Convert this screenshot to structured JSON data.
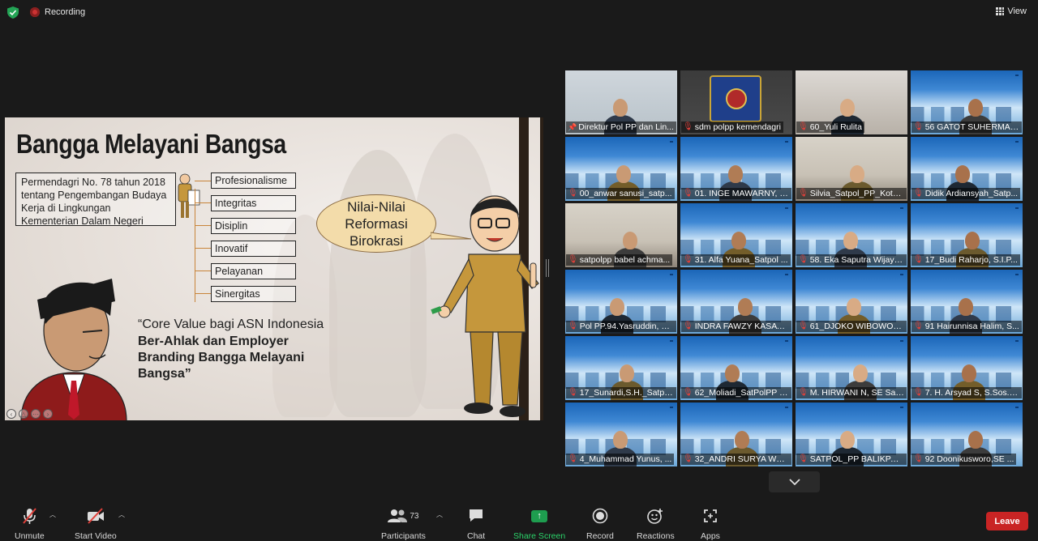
{
  "topbar": {
    "recording_label": "Recording",
    "view_label": "View"
  },
  "slide": {
    "title": "Bangga Melayani Bangsa",
    "regulation": "Permendagri No. 78 tahun 2018 tentang  Pengembangan Budaya Kerja di Lingkungan Kementerian Dalam Negeri",
    "values": [
      "Profesionalisme",
      "Integritas",
      "Disiplin",
      "Inovatif",
      "Pelayanan",
      "Sinergitas"
    ],
    "bubble": "Nilai-Nilai Reformasi Birokrasi",
    "quote_line1": "“Core Value bagi ASN Indonesia",
    "quote_line2": "Ber-Ahlak dan Employer Branding Bangga Melayani Bangsa”",
    "nav_icons": [
      "prev-icon",
      "up-icon",
      "more-icon",
      "next-icon"
    ]
  },
  "gallery": {
    "tiles": [
      {
        "name": "Direktur Pol PP dan Lin...",
        "bg": "office",
        "pinned": true
      },
      {
        "name": "sdm polpp kemendagri",
        "bg": "dark"
      },
      {
        "name": "60_Yuli Rulita",
        "bg": "gray"
      },
      {
        "name": "56 GATOT SUHERMAN...",
        "bg": "asn"
      },
      {
        "name": "00_anwar sanusi_satp...",
        "bg": "asn"
      },
      {
        "name": "01. INGE MAWARNY, S...",
        "bg": "asn"
      },
      {
        "name": "Silvia_Satpol_PP_Kota_...",
        "bg": "room"
      },
      {
        "name": "Didik Ardiansyah_Satp...",
        "bg": "asn"
      },
      {
        "name": "satpolpp babel achma...",
        "bg": "room"
      },
      {
        "name": "31. Alfa Yuana_Satpol ...",
        "bg": "asn"
      },
      {
        "name": "58. Eka Saputra Wijaya...",
        "bg": "asn"
      },
      {
        "name": "17_Budi Raharjo, S.I.P...",
        "bg": "asn"
      },
      {
        "name": "Pol PP.94.Yasruddin, S...",
        "bg": "asn"
      },
      {
        "name": "INDRA FAWZY KASATP...",
        "bg": "asn"
      },
      {
        "name": "61_DJOKO WIBOWO_...",
        "bg": "asn"
      },
      {
        "name": "91 Hairunnisa Halim, S...",
        "bg": "asn"
      },
      {
        "name": "17_Sunardi,S.H._Satpol...",
        "bg": "asn"
      },
      {
        "name": "62_Moliadi_SatPolPP K...",
        "bg": "asn"
      },
      {
        "name": "M. HIRWANI N, SE Sat...",
        "bg": "asn"
      },
      {
        "name": "7. H. Arsyad S, S.Sos., ...",
        "bg": "asn"
      },
      {
        "name": "4_Muhammad Yunus, ...",
        "bg": "asn"
      },
      {
        "name": "32_ANDRI SURYA W_S...",
        "bg": "asn"
      },
      {
        "name": "SATPOL_PP BALIKPAPA...",
        "bg": "asn"
      },
      {
        "name": "92 Doonikusworo,SE ...",
        "bg": "asn"
      }
    ]
  },
  "toolbar": {
    "unmute": "Unmute",
    "start_video": "Start Video",
    "participants": "Participants",
    "participant_count": "73",
    "chat": "Chat",
    "share_screen": "Share Screen",
    "record": "Record",
    "reactions": "Reactions",
    "apps": "Apps",
    "leave": "Leave"
  }
}
